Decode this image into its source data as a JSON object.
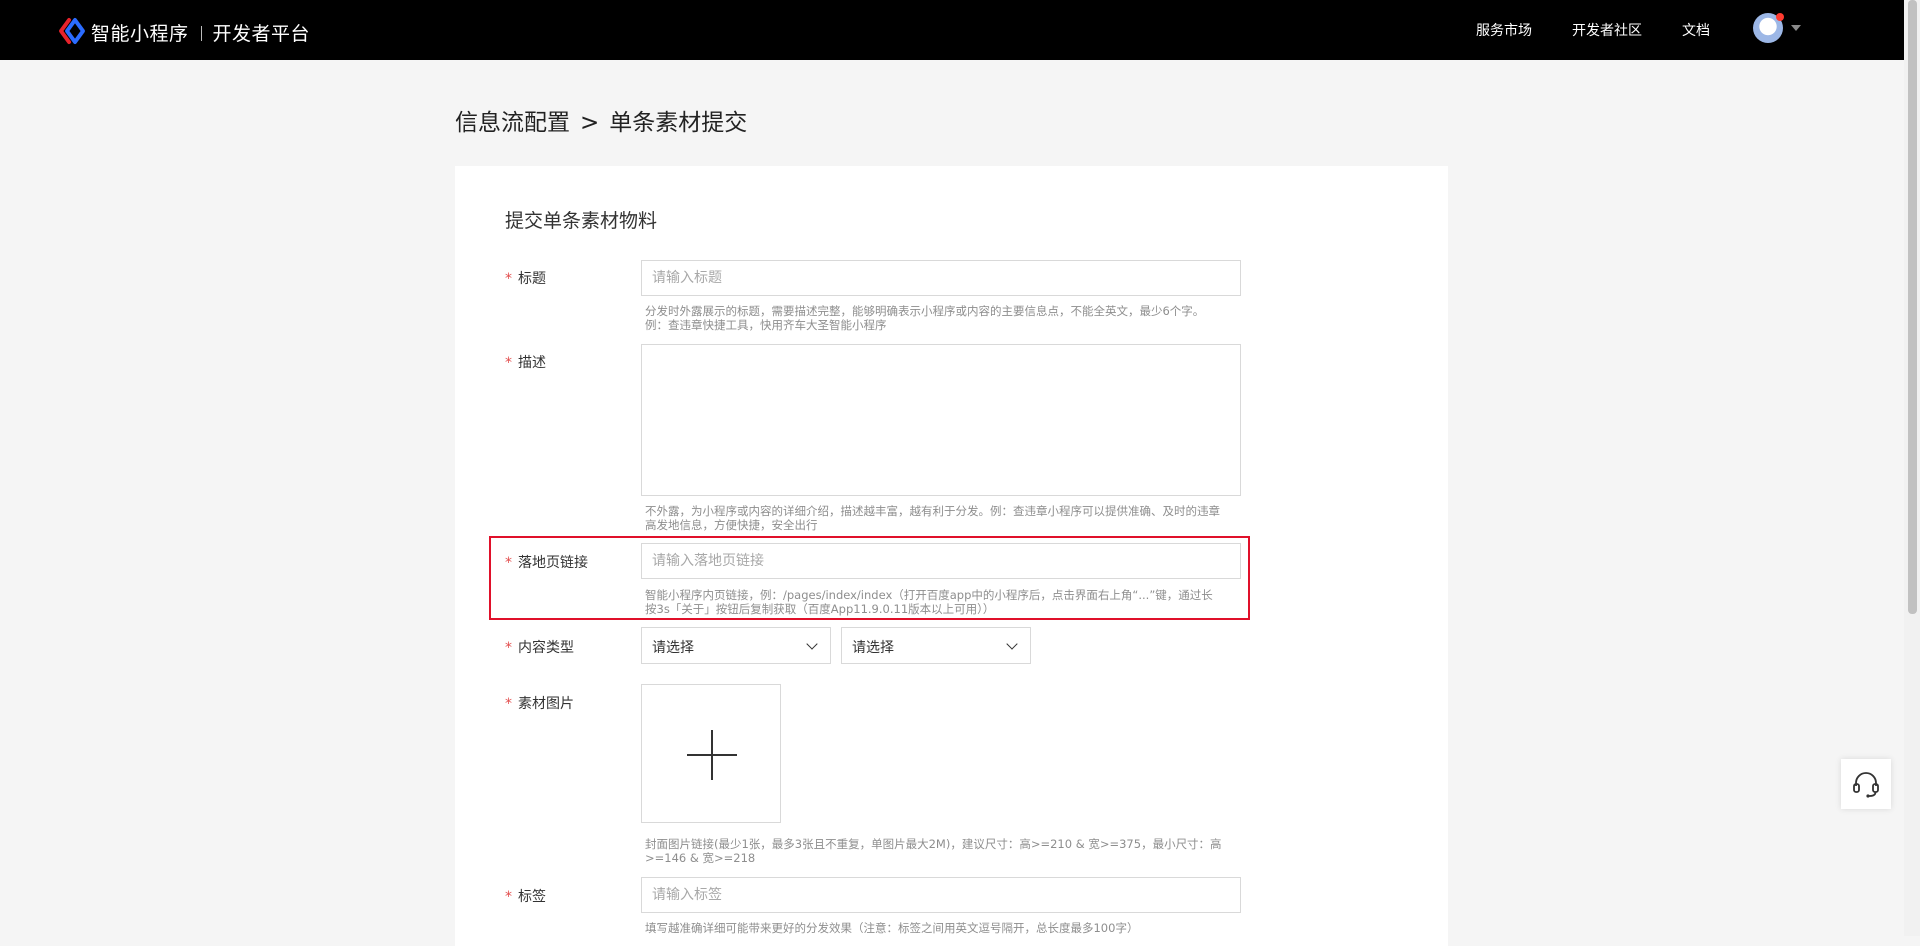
{
  "header": {
    "brand_name": "智能小程序",
    "platform_name": "开发者平台",
    "nav": [
      "服务市场",
      "开发者社区",
      "文档"
    ]
  },
  "breadcrumb": {
    "parent": "信息流配置",
    "separator": ">",
    "current": "单条素材提交"
  },
  "form": {
    "title": "提交单条素材物料",
    "required_mark": "*",
    "fields": {
      "title": {
        "label": "标题",
        "placeholder": "请输入标题",
        "hint_line1": "分发时外露展示的标题，需要描述完整，能够明确表示小程序或内容的主要信息点，不能全英文，最少6个字。",
        "hint_line2": "例：查违章快捷工具，快用齐车大圣智能小程序"
      },
      "description": {
        "label": "描述",
        "hint_line1": "不外露，为小程序或内容的详细介绍，描述越丰富，越有利于分发。例：查违章小程序可以提供准确、及时的违章",
        "hint_line2": "高发地信息，方便快捷，安全出行"
      },
      "landing": {
        "label": "落地页链接",
        "placeholder": "请输入落地页链接",
        "hint_line1": "智能小程序内页链接，例：/pages/index/index（打开百度app中的小程序后，点击界面右上角“...”键，通过长",
        "hint_line2": "按3s「关于」按钮后复制获取（百度App11.9.0.11版本以上可用））"
      },
      "content_type": {
        "label": "内容类型",
        "select1": "请选择",
        "select2": "请选择"
      },
      "image": {
        "label": "素材图片",
        "hint_line1": "封面图片链接(最少1张，最多3张且不重复，单图片最大2M)，建议尺寸：高>=210 & 宽>=375，最小尺寸：高",
        "hint_line2": ">=146 & 宽>=218"
      },
      "tags": {
        "label": "标签",
        "placeholder": "请输入标签",
        "hint_line1": "填写越准确详细可能带来更好的分发效果（注意：标签之间用英文逗号隔开，总长度最多100字）"
      }
    }
  },
  "colors": {
    "topbar": "#000000",
    "required": "#e24c4c",
    "highlight": "#e0102a",
    "logo_red": "#e8222b",
    "logo_blue": "#2b6cff"
  },
  "icons": [
    "logo-icon",
    "avatar",
    "caret-down-icon",
    "chevron-down-icon",
    "plus-icon",
    "headset-icon"
  ]
}
